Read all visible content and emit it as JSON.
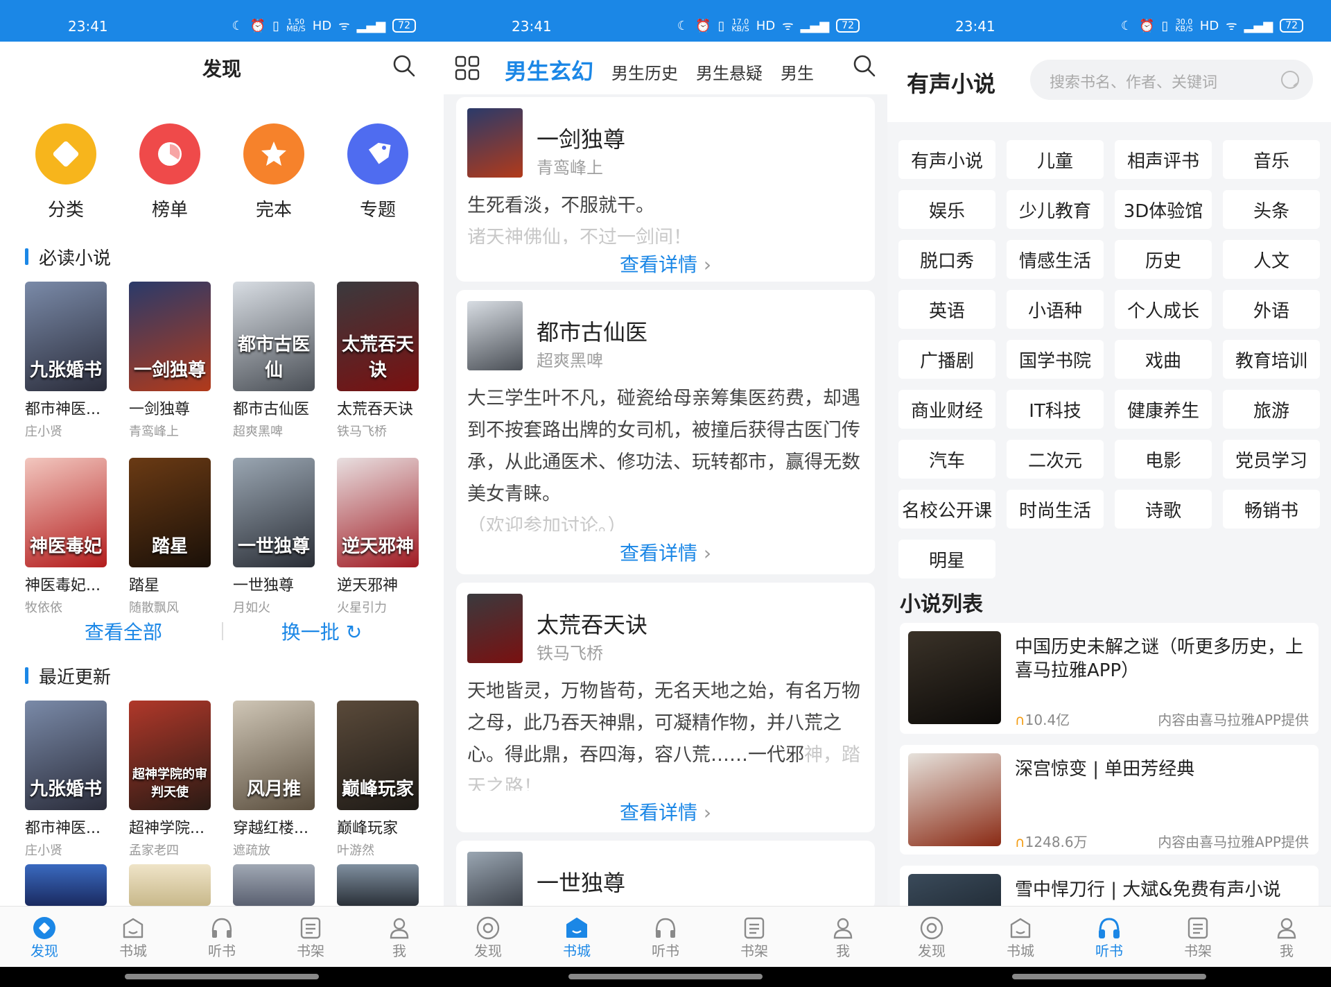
{
  "status": {
    "time": "23:41",
    "battery": "72",
    "panels": [
      {
        "speed_top": "1.50",
        "speed_bot": "MB/S"
      },
      {
        "speed_top": "17.0",
        "speed_bot": "KB/S"
      },
      {
        "speed_top": "30.0",
        "speed_bot": "KB/S"
      }
    ]
  },
  "nav": {
    "items": [
      "发现",
      "书城",
      "听书",
      "书架",
      "我"
    ]
  },
  "discover": {
    "title": "发现",
    "categories": [
      {
        "label": "分类",
        "color": "#f7b51c"
      },
      {
        "label": "榜单",
        "color": "#ef4a4a"
      },
      {
        "label": "完本",
        "color": "#f6822b"
      },
      {
        "label": "专题",
        "color": "#4f6cf0"
      }
    ],
    "must_read_title": "必读小说",
    "must_read": [
      {
        "name": "都市神医...",
        "author": "庄小贤",
        "cover_text": "九张婚书",
        "c1": "#7a8aa8",
        "c2": "#2a2c3a"
      },
      {
        "name": "一剑独尊",
        "author": "青鸾峰上",
        "cover_text": "一剑独尊",
        "c1": "#2a3a6a",
        "c2": "#b23a1a"
      },
      {
        "name": "都市古仙医",
        "author": "超爽黑啤",
        "cover_text": "都市古医仙",
        "c1": "#d8dde3",
        "c2": "#4a4f56"
      },
      {
        "name": "太荒吞天诀",
        "author": "铁马飞桥",
        "cover_text": "太荒吞天诀",
        "c1": "#3a3a3e",
        "c2": "#7a1010"
      },
      {
        "name": "神医毒妃...",
        "author": "牧依依",
        "cover_text": "神医毒妃",
        "c1": "#f2c7bf",
        "c2": "#b31c1c"
      },
      {
        "name": "踏星",
        "author": "随散飘风",
        "cover_text": "踏星",
        "c1": "#6a3a14",
        "c2": "#1a1008"
      },
      {
        "name": "一世独尊",
        "author": "月如火",
        "cover_text": "一世独尊",
        "c1": "#9aa6b2",
        "c2": "#2a2e36"
      },
      {
        "name": "逆天邪神",
        "author": "火星引力",
        "cover_text": "逆天邪神",
        "c1": "#e8dfe0",
        "c2": "#a01a22"
      }
    ],
    "view_all": "查看全部",
    "refresh": "换一批",
    "recent_title": "最近更新",
    "recent": [
      {
        "name": "都市神医...",
        "author": "庄小贤",
        "cover_text": "九张婚书",
        "c1": "#7a8aa8",
        "c2": "#2a2c3a"
      },
      {
        "name": "超神学院...",
        "author": "孟家老四",
        "cover_text": "超神学院的审判天使",
        "c1": "#b0382a",
        "c2": "#2a1a14"
      },
      {
        "name": "穿越红楼...",
        "author": "遮疏放",
        "cover_text": "风月推",
        "c1": "#cfc6b6",
        "c2": "#5a4e3e"
      },
      {
        "name": "巅峰玩家",
        "author": "叶游然",
        "cover_text": "巅峰玩家",
        "c1": "#5a4a3a",
        "c2": "#1e1a16"
      }
    ]
  },
  "bookstore": {
    "tabs": [
      "男生玄幻",
      "男生历史",
      "男生悬疑",
      "男生"
    ],
    "cards": [
      {
        "title": "一剑独尊",
        "author": "青鸾峰上",
        "desc": "生死看淡，不服就干。",
        "fade": "诸天神佛仙，不过一剑间！",
        "more": "查看详情",
        "c1": "#2a3a6a",
        "c2": "#b23a1a"
      },
      {
        "title": "都市古仙医",
        "author": "超爽黑啤",
        "desc": "大三学生叶不凡，碰瓷给母亲筹集医药费，却遇到不按套路出牌的女司机，被撞后获得古医门传承，从此通医术、修功法、玩转都市，赢得无数美女青睐。",
        "fade": "（欢迎参加讨论。）",
        "more": "查看详情",
        "c1": "#d8dde3",
        "c2": "#4a4f56"
      },
      {
        "title": "太荒吞天诀",
        "author": "铁马飞桥",
        "desc": "天地皆灵，万物皆苟，无名天地之始，有名万物之母，此乃吞天神鼎，可凝精作物，并八荒之心。得此鼎，吞四海，容八荒……一代邪",
        "fade": "神，踏天之路！",
        "more": "查看详情",
        "c1": "#3a3a3e",
        "c2": "#7a1010"
      },
      {
        "title": "一世独尊",
        "author": "",
        "desc": "",
        "fade": "",
        "more": "",
        "c1": "#9aa6b2",
        "c2": "#2a2e36"
      }
    ]
  },
  "audio": {
    "title": "有声小说",
    "search_placeholder": "搜索书名、作者、关键词",
    "tags": [
      "有声小说",
      "儿童",
      "相声评书",
      "音乐",
      "娱乐",
      "少儿教育",
      "3D体验馆",
      "头条",
      "脱口秀",
      "情感生活",
      "历史",
      "人文",
      "英语",
      "小语种",
      "个人成长",
      "外语",
      "广播剧",
      "国学书院",
      "戏曲",
      "教育培训",
      "商业财经",
      "IT科技",
      "健康养生",
      "旅游",
      "汽车",
      "二次元",
      "电影",
      "党员学习",
      "名校公开课",
      "时尚生活",
      "诗歌",
      "畅销书",
      "明星"
    ],
    "list_title": "小说列表",
    "list": [
      {
        "title": "中国历史未解之谜（听更多历史，上喜马拉雅APP）",
        "plays": "10.4亿",
        "source": "内容由喜马拉雅APP提供",
        "c1": "#3a3228",
        "c2": "#0c0a08"
      },
      {
        "title": "深宫惊变 | 单田芳经典",
        "plays": "1248.6万",
        "source": "内容由喜马拉雅APP提供",
        "c1": "#e6e2dc",
        "c2": "#8a2a14"
      },
      {
        "title": "雪中悍刀行 | 大斌&免费有声小说",
        "plays": "",
        "source": "",
        "c1": "#3a4a5a",
        "c2": "#0e141a"
      }
    ]
  }
}
